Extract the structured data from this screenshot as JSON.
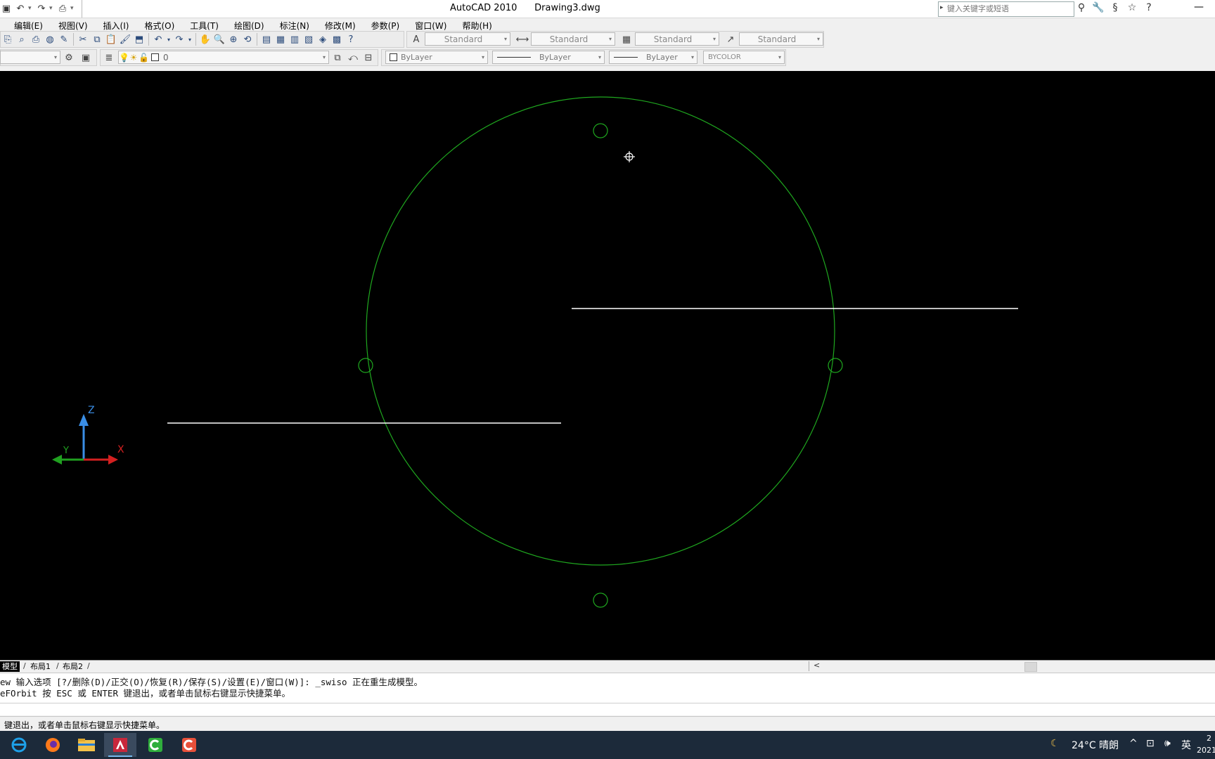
{
  "app": {
    "title": "AutoCAD 2010      Drawing3.dwg",
    "search_placeholder": "键入关键字或短语"
  },
  "menu": [
    "编辑(E)",
    "视图(V)",
    "插入(I)",
    "格式(O)",
    "工具(T)",
    "绘图(D)",
    "标注(N)",
    "修改(M)",
    "参数(P)",
    "窗口(W)",
    "帮助(H)"
  ],
  "styles_toolbar": {
    "text_style": "Standard",
    "dim_style": "Standard",
    "table_style": "Standard",
    "multileader_style": "Standard"
  },
  "layers_toolbar": {
    "layer_name": "0",
    "color": "ByLayer",
    "linetype": "ByLayer",
    "lineweight": "ByLayer",
    "plot_style": "BYCOLOR"
  },
  "ucs": {
    "z": "Z",
    "y": "Y",
    "x": "X"
  },
  "tabs": {
    "model": "模型",
    "layout1": "布局1",
    "layout2": "布局2"
  },
  "command": {
    "line1": "ew 输入选项 [?/删除(D)/正交(O)/恢复(R)/保存(S)/设置(E)/窗口(W)]: _swiso 正在重生成模型。",
    "line2": "eFOrbit 按 ESC 或 ENTER 键退出，或者单击鼠标右键显示快捷菜单。"
  },
  "status": "键退出，或者单击鼠标右键显示快捷菜单。",
  "taskbar": {
    "weather": "24°C 晴朗",
    "ime": "英",
    "clock_time": "2",
    "clock_date": "2021"
  },
  "colors": {
    "canvas": "#000000",
    "circle": "#1fa81f",
    "line": "#ffffff",
    "axis_x": "#d42020",
    "axis_y": "#20a020",
    "axis_z": "#3a8ee6"
  }
}
